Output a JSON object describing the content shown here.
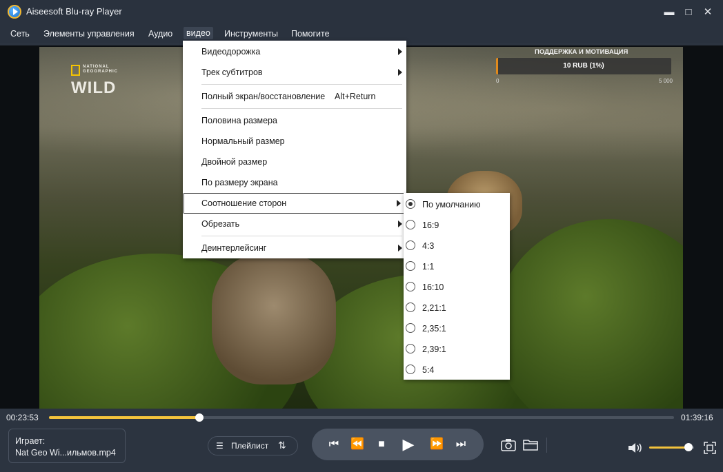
{
  "window": {
    "title": "Aiseesoft Blu-ray Player",
    "minimize": "▬",
    "maximize": "□",
    "close": "✕"
  },
  "menubar": [
    "Сеть",
    "Элементы управления",
    "Аудио",
    "видео",
    "Инструменты",
    "Помогите"
  ],
  "video_overlay": {
    "channel_logo_small": "NATIONAL GEOGRAPHIC",
    "channel_logo": "WILD",
    "donation_title": "ПОДДЕРЖКА И МОТИВАЦИЯ",
    "donation_value": "10 RUB (1%)",
    "donation_progress": 0.01,
    "donation_min": "0",
    "donation_max": "5 000"
  },
  "video_menu": {
    "items": [
      {
        "label": "Видеодорожка",
        "submenu": true
      },
      {
        "label": "Трек субтитров",
        "submenu": true
      },
      {
        "label": "Полный экран/восстановление",
        "shortcut": "Alt+Return"
      },
      {
        "label": "Половина размера"
      },
      {
        "label": "Нормальный размер"
      },
      {
        "label": "Двойной размер"
      },
      {
        "label": "По размеру экрана"
      },
      {
        "label": "Соотношение сторон",
        "submenu": true,
        "highlighted": true
      },
      {
        "label": "Обрезать",
        "submenu": true
      },
      {
        "label": "Деинтерлейсинг",
        "submenu": true
      }
    ]
  },
  "aspect_submenu": {
    "selected": "По умолчанию",
    "options": [
      "По умолчанию",
      "16:9",
      "4:3",
      "1:1",
      "16:10",
      "2,21:1",
      "2,35:1",
      "2,39:1",
      "5:4"
    ]
  },
  "playback": {
    "current_time": "00:23:53",
    "total_time": "01:39:16",
    "progress": 0.241,
    "volume": 0.88
  },
  "now_playing": {
    "label": "Играет:",
    "file": "Nat Geo Wi...ильмов.mp4"
  },
  "playlist": {
    "label": "Плейлист"
  },
  "icons": {
    "playlist": "list-icon",
    "sort": "sort-icon",
    "prev": "skip-previous-icon",
    "rewind": "rewind-icon",
    "stop": "stop-icon",
    "play": "play-icon",
    "forward": "fast-forward-icon",
    "next": "skip-next-icon",
    "snapshot": "camera-icon",
    "folder": "folder-icon",
    "volume": "volume-icon",
    "fullscreen": "fullscreen-icon"
  },
  "colors": {
    "accent": "#f3c23c",
    "background": "#2c3440",
    "donation_fill": "#e08a1d"
  }
}
